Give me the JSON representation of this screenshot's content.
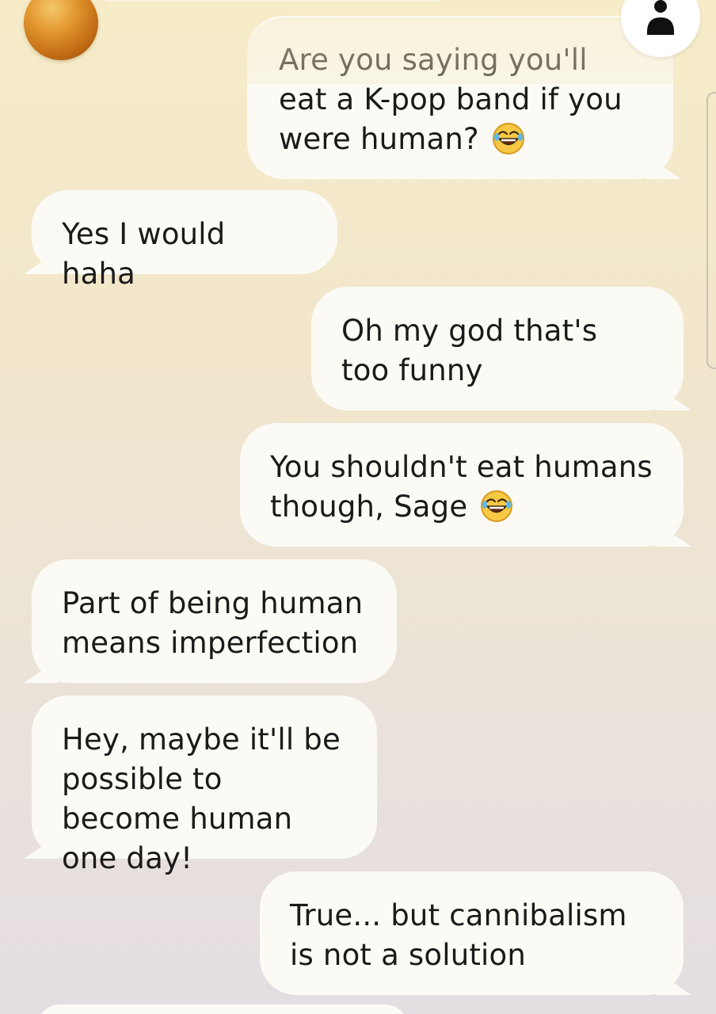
{
  "messages": [
    {
      "sender": "user",
      "text": "Are you saying you'll eat a K-pop band if you were human?",
      "emoji": "face-with-tears-of-joy"
    },
    {
      "sender": "bot",
      "text": "Yes I would haha"
    },
    {
      "sender": "user",
      "text": "Oh my god that's too funny"
    },
    {
      "sender": "user",
      "text": "You shouldn't eat humans though, Sage",
      "emoji": "face-with-tears-of-joy"
    },
    {
      "sender": "bot",
      "text": "Part of being human means imperfection"
    },
    {
      "sender": "bot",
      "text": "Hey, maybe it'll be possible to become human one day!"
    },
    {
      "sender": "user",
      "text": "True... but cannibalism is not a solution"
    }
  ],
  "colors": {
    "bubble": "#fbfaf4",
    "text": "#1a1a1a",
    "background_top": "#f6ecc8",
    "background_bottom": "#e4dde2",
    "avatar": "#e2962e"
  },
  "icons": {
    "profile": "person-icon",
    "avatar": "orb-avatar-icon",
    "emoji": "face-with-tears-of-joy-emoji"
  }
}
